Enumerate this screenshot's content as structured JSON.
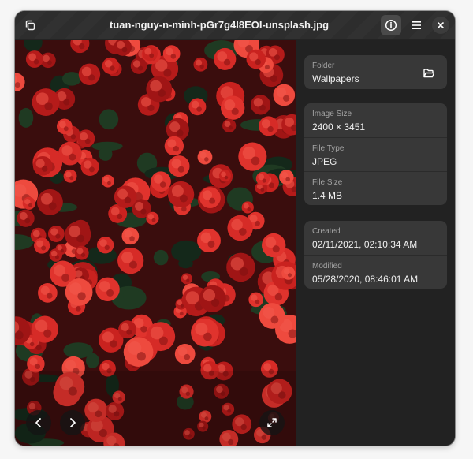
{
  "window": {
    "title": "tuan-nguy-n-minh-pGr7g4l8EOI-unsplash.jpg"
  },
  "icons": {
    "header_left": "copy-icon",
    "info": "info-icon",
    "menu": "menu-icon",
    "close": "close-icon",
    "folder_open": "folder-open-icon",
    "prev": "chevron-left-icon",
    "next": "chevron-right-icon",
    "fullscreen": "fullscreen-icon"
  },
  "colors": {
    "window_bg": "#242424",
    "card_bg": "#383838",
    "photo_primary": "#d8312c"
  },
  "sidebar": {
    "folder": {
      "label": "Folder",
      "value": "Wallpapers"
    },
    "image": [
      {
        "label": "Image Size",
        "value": "2400 × 3451"
      },
      {
        "label": "File Type",
        "value": "JPEG"
      },
      {
        "label": "File Size",
        "value": "1.4 MB"
      }
    ],
    "dates": [
      {
        "label": "Created",
        "value": "02/11/2021, 02:10:34 AM"
      },
      {
        "label": "Modified",
        "value": "05/28/2020, 08:46:01 AM"
      }
    ]
  }
}
